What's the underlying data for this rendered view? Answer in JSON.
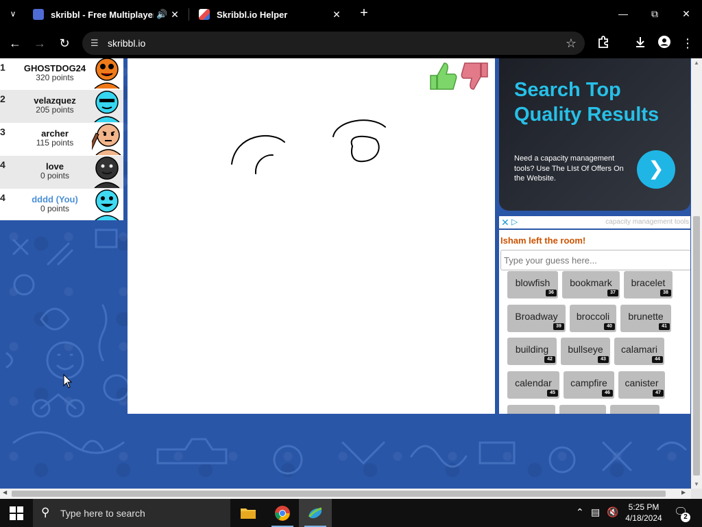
{
  "browser": {
    "tabs": [
      {
        "title": "skribbl - Free Multiplayer D",
        "active": true
      },
      {
        "title": "Skribbl.io Helper",
        "active": false
      }
    ],
    "url": "skribbl.io"
  },
  "players": [
    {
      "rank": "1",
      "name": "GHOSTDOG24",
      "points": "320 points",
      "avatar_color": "#f07a1a"
    },
    {
      "rank": "2",
      "name": "velazquez",
      "points": "205 points",
      "avatar_color": "#36d6f0"
    },
    {
      "rank": "3",
      "name": "archer",
      "points": "115 points",
      "avatar_color": "#f2b48a"
    },
    {
      "rank": "4",
      "name": "love",
      "points": "0 points",
      "avatar_color": "#333333"
    },
    {
      "rank": "4",
      "name": "dddd (You)",
      "points": "0 points",
      "avatar_color": "#3fd9f2"
    }
  ],
  "ad": {
    "headline": "Search Top Quality Results",
    "body": "Need a capacity management tools? Use The LIst Of Offers On the Website.",
    "info_text": "capacity management tools"
  },
  "chat": {
    "message": "Isham left the room!",
    "guess_placeholder": "Type your guess here..."
  },
  "words": [
    {
      "word": "blowfish",
      "num": "36"
    },
    {
      "word": "bookmark",
      "num": "37"
    },
    {
      "word": "bracelet",
      "num": "38"
    },
    {
      "word": "Broadway",
      "num": "39"
    },
    {
      "word": "broccoli",
      "num": "40"
    },
    {
      "word": "brunette",
      "num": "41"
    },
    {
      "word": "building",
      "num": "42"
    },
    {
      "word": "bullseye",
      "num": "43"
    },
    {
      "word": "calamari",
      "num": "44"
    },
    {
      "word": "calendar",
      "num": "45"
    },
    {
      "word": "campfire",
      "num": "46"
    },
    {
      "word": "canister",
      "num": "47"
    }
  ],
  "taskbar": {
    "search_placeholder": "Type here to search",
    "time": "5:25 PM",
    "date": "4/18/2024",
    "notification_count": "2"
  },
  "colors": {
    "page_bg": "#2a56a8",
    "accent_cyan": "#27c0e8",
    "chat_system": "#cc5200",
    "you_name": "#4a8fd6"
  }
}
